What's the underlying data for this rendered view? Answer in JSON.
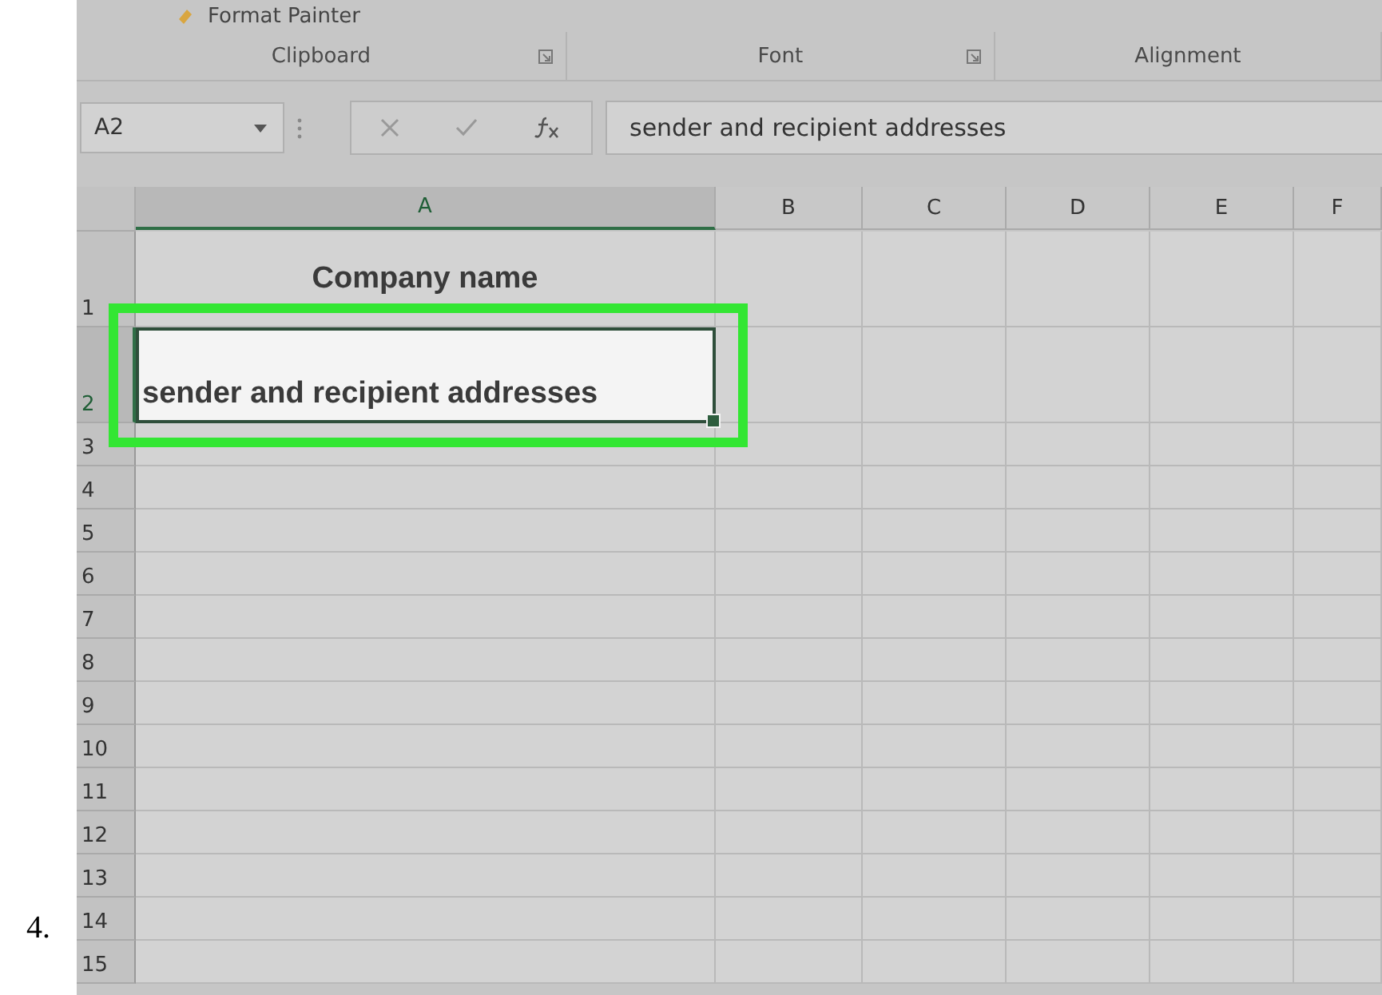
{
  "step_number": "4.",
  "ribbon": {
    "top_items": [
      {
        "label": "Format Painter"
      }
    ],
    "groups": [
      {
        "label": "Clipboard",
        "launcher": true
      },
      {
        "label": "Font",
        "launcher": true
      },
      {
        "label": "Alignment",
        "launcher": false
      }
    ]
  },
  "formula_bar": {
    "name_box": "A2",
    "formula": "sender and recipient addresses"
  },
  "columns": [
    {
      "label": "A",
      "selected": true
    },
    {
      "label": "B",
      "selected": false
    },
    {
      "label": "C",
      "selected": false
    },
    {
      "label": "D",
      "selected": false
    },
    {
      "label": "E",
      "selected": false
    },
    {
      "label": "F",
      "selected": false
    }
  ],
  "rows": [
    {
      "label": "1",
      "selected": false,
      "cell_a": "Company name",
      "kind": "title"
    },
    {
      "label": "2",
      "selected": true,
      "cell_a": "sender and recipient addresses",
      "kind": "entry",
      "highlighted": true
    },
    {
      "label": "3",
      "selected": false
    },
    {
      "label": "4",
      "selected": false
    },
    {
      "label": "5",
      "selected": false
    },
    {
      "label": "6",
      "selected": false
    },
    {
      "label": "7",
      "selected": false
    },
    {
      "label": "8",
      "selected": false
    },
    {
      "label": "9",
      "selected": false
    },
    {
      "label": "10",
      "selected": false
    },
    {
      "label": "11",
      "selected": false
    },
    {
      "label": "12",
      "selected": false
    },
    {
      "label": "13",
      "selected": false
    },
    {
      "label": "14",
      "selected": false
    },
    {
      "label": "15",
      "selected": false
    }
  ]
}
